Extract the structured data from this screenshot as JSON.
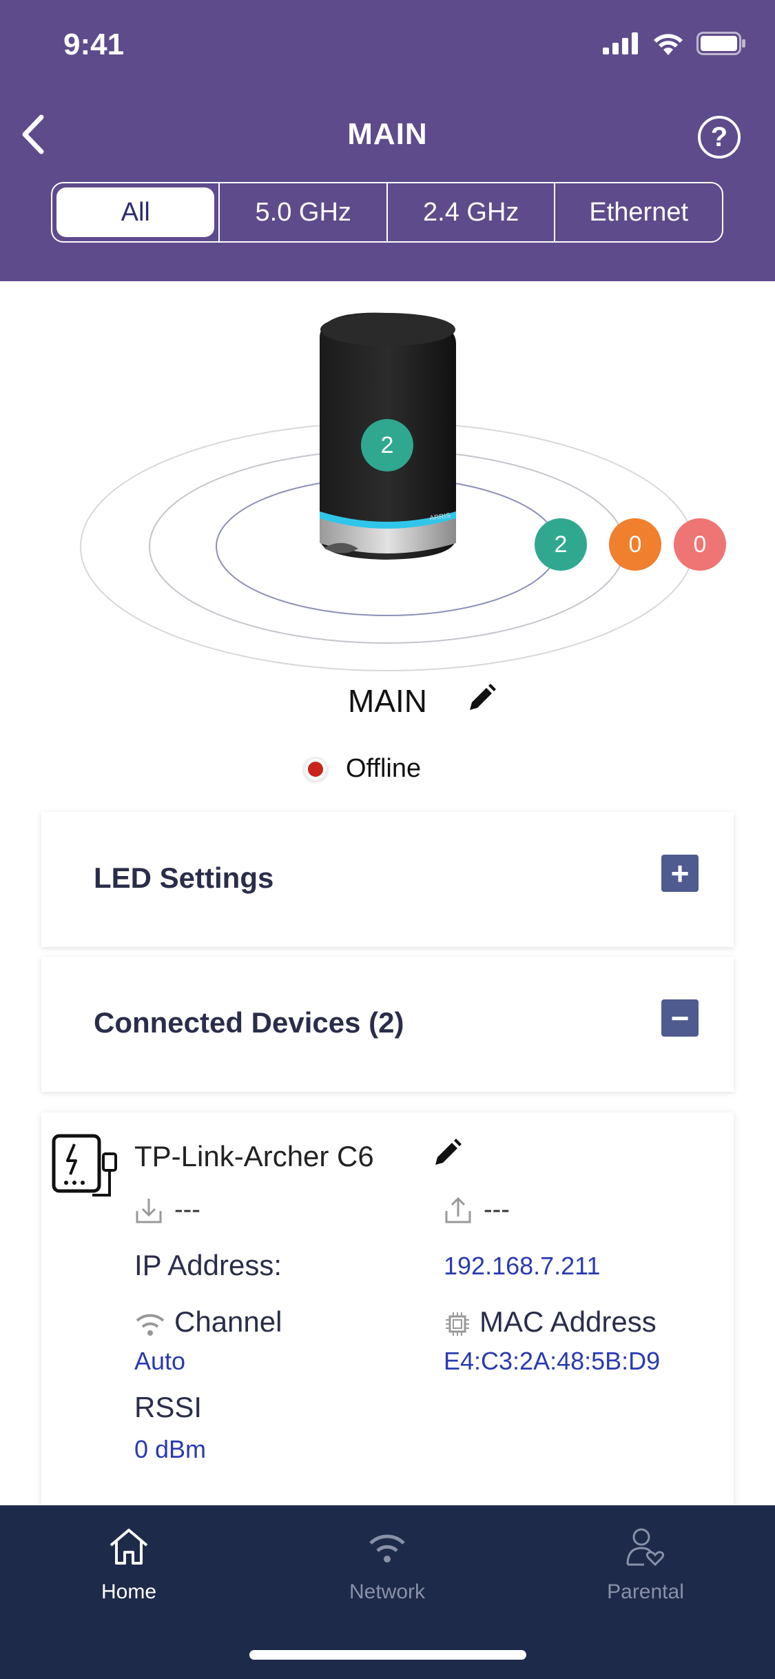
{
  "status_bar": {
    "time": "9:41"
  },
  "nav": {
    "title": "MAIN",
    "help_label": "?"
  },
  "segments": [
    {
      "label": "All",
      "active": true
    },
    {
      "label": "5.0 GHz",
      "active": false
    },
    {
      "label": "2.4 GHz",
      "active": false
    },
    {
      "label": "Ethernet",
      "active": false
    }
  ],
  "router": {
    "brand": "ARRIS",
    "center_count": "2",
    "badges": [
      {
        "value": "2",
        "color": "#2fa88f"
      },
      {
        "value": "0",
        "color": "#f07f2e"
      },
      {
        "value": "0",
        "color": "#ef7474"
      }
    ]
  },
  "device": {
    "name": "MAIN",
    "status": "Offline",
    "status_color": "#c9231c"
  },
  "led_settings": {
    "title": "LED Settings",
    "toggle": "+"
  },
  "connected_devices": {
    "title": "Connected Devices (2)",
    "toggle": "−"
  },
  "client": {
    "name": "TP-Link-Archer C6",
    "download": "---",
    "upload": "---",
    "ip_label": "IP Address:",
    "ip_value": "192.168.7.211",
    "channel_label": "Channel",
    "channel_value": "Auto",
    "mac_label": "MAC Address",
    "mac_value": "E4:C3:2A:48:5B:D9",
    "rssi_label": "RSSI",
    "rssi_value": "0 dBm"
  },
  "tabbar": {
    "home": "Home",
    "network": "Network",
    "parental": "Parental"
  },
  "colors": {
    "header": "#5e4b8b",
    "tabbar": "#1e2a4a",
    "accent_blue": "#2a3ab0",
    "button": "#4f5b8f"
  }
}
